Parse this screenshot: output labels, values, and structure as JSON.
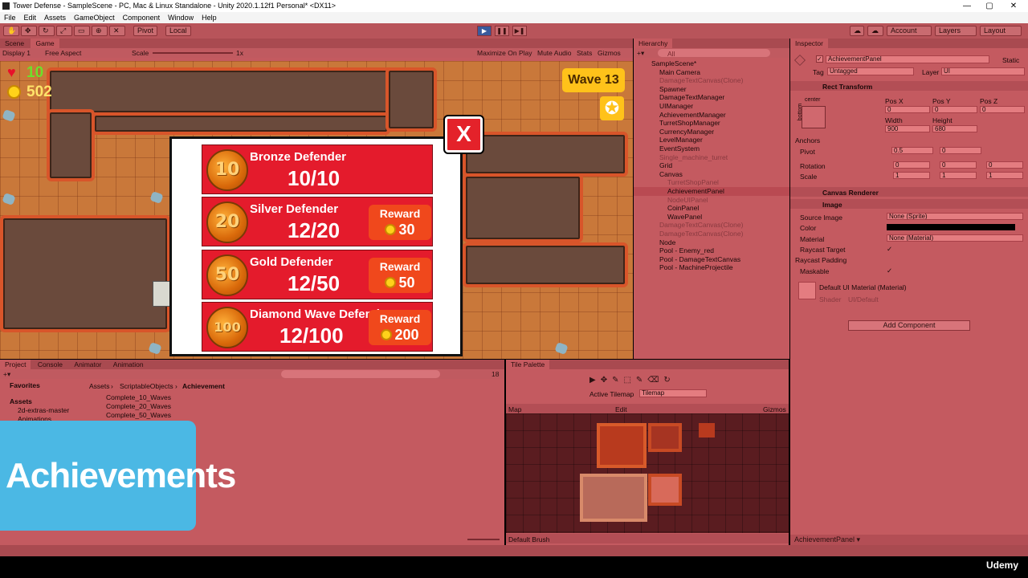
{
  "window": {
    "title": "Tower Defense - SampleScene - PC, Mac & Linux Standalone - Unity 2020.1.12f1 Personal* <DX11>",
    "min": "—",
    "max": "▢",
    "close": "✕"
  },
  "menu": [
    "File",
    "Edit",
    "Assets",
    "GameObject",
    "Component",
    "Window",
    "Help"
  ],
  "toolbar": {
    "pivot": "Pivot",
    "local": "Local",
    "account": "Account",
    "layers": "Layers",
    "layout": "Layout"
  },
  "scene_tabs": {
    "scene": "Scene",
    "game": "Game"
  },
  "game_bar": {
    "display": "Display 1",
    "aspect": "Free Aspect",
    "scale_label": "Scale",
    "scale_value": "1x",
    "maximize": "Maximize On Play",
    "mute": "Mute Audio",
    "stats": "Stats",
    "gizmos": "Gizmos"
  },
  "hud": {
    "lives": "10",
    "coins": "502",
    "wave": "Wave 13"
  },
  "achievements": [
    {
      "medal": "10",
      "title": "Bronze Defender",
      "progress": "10/10",
      "reward_label": "",
      "reward": ""
    },
    {
      "medal": "20",
      "title": "Silver Defender",
      "progress": "12/20",
      "reward_label": "Reward",
      "reward": "30"
    },
    {
      "medal": "50",
      "title": "Gold Defender",
      "progress": "12/50",
      "reward_label": "Reward",
      "reward": "50"
    },
    {
      "medal": "100",
      "title": "Diamond Wave Defender",
      "progress": "12/100",
      "reward_label": "Reward",
      "reward": "200"
    }
  ],
  "close_label": "X",
  "hierarchy": {
    "tab": "Hierarchy",
    "search": "All",
    "items": [
      {
        "label": "SampleScene*",
        "indent": 0,
        "dim": false,
        "sel": false
      },
      {
        "label": "Main Camera",
        "indent": 1,
        "dim": false,
        "sel": false
      },
      {
        "label": "DamageTextCanvas(Clone)",
        "indent": 1,
        "dim": true,
        "sel": false
      },
      {
        "label": "Spawner",
        "indent": 1,
        "dim": false,
        "sel": false
      },
      {
        "label": "DamageTextManager",
        "indent": 1,
        "dim": false,
        "sel": false
      },
      {
        "label": "UIManager",
        "indent": 1,
        "dim": false,
        "sel": false
      },
      {
        "label": "AchievementManager",
        "indent": 1,
        "dim": false,
        "sel": false
      },
      {
        "label": "TurretShopManager",
        "indent": 1,
        "dim": false,
        "sel": false
      },
      {
        "label": "CurrencyManager",
        "indent": 1,
        "dim": false,
        "sel": false
      },
      {
        "label": "LevelManager",
        "indent": 1,
        "dim": false,
        "sel": false
      },
      {
        "label": "EventSystem",
        "indent": 1,
        "dim": false,
        "sel": false
      },
      {
        "label": "Single_machine_turret",
        "indent": 1,
        "dim": true,
        "sel": false
      },
      {
        "label": "Grid",
        "indent": 1,
        "dim": false,
        "sel": false
      },
      {
        "label": "Canvas",
        "indent": 1,
        "dim": false,
        "sel": false
      },
      {
        "label": "TurretShopPanel",
        "indent": 2,
        "dim": true,
        "sel": false
      },
      {
        "label": "AchievementPanel",
        "indent": 2,
        "dim": false,
        "sel": true
      },
      {
        "label": "NodeUIPanel",
        "indent": 2,
        "dim": true,
        "sel": false
      },
      {
        "label": "CoinPanel",
        "indent": 2,
        "dim": false,
        "sel": false
      },
      {
        "label": "WavePanel",
        "indent": 2,
        "dim": false,
        "sel": false
      },
      {
        "label": "DamageTextCanvas(Clone)",
        "indent": 1,
        "dim": true,
        "sel": false
      },
      {
        "label": "DamageTextCanvas(Clone)",
        "indent": 1,
        "dim": true,
        "sel": false
      },
      {
        "label": "Node",
        "indent": 1,
        "dim": false,
        "sel": false
      },
      {
        "label": "Pool - Enemy_red",
        "indent": 1,
        "dim": false,
        "sel": false
      },
      {
        "label": "Pool - DamageTextCanvas",
        "indent": 1,
        "dim": false,
        "sel": false
      },
      {
        "label": "Pool - MachineProjectile",
        "indent": 1,
        "dim": false,
        "sel": false
      }
    ]
  },
  "inspector": {
    "tab": "Inspector",
    "name": "AchievementPanel",
    "static": "Static",
    "tag_label": "Tag",
    "tag": "Untagged",
    "layer_label": "Layer",
    "layer": "UI",
    "rect_transform": "Rect Transform",
    "anchor_h": "center",
    "anchor_v": "bottom",
    "posx_l": "Pos X",
    "posy_l": "Pos Y",
    "posz_l": "Pos Z",
    "posx": "0",
    "posy": "0",
    "posz": "0",
    "width_l": "Width",
    "height_l": "Height",
    "width": "900",
    "height": "680",
    "anchors": "Anchors",
    "pivot": "Pivot",
    "pivot_x": "0.5",
    "pivot_y": "0",
    "rotation": "Rotation",
    "rot_x": "0",
    "rot_y": "0",
    "rot_z": "0",
    "scale": "Scale",
    "scale_x": "1",
    "scale_y": "1",
    "scale_z": "1",
    "canvas_renderer": "Canvas Renderer",
    "image": "Image",
    "source_image_l": "Source Image",
    "source_image": "None (Sprite)",
    "color_l": "Color",
    "material_l": "Material",
    "material": "None (Material)",
    "raycast_target": "Raycast Target",
    "raycast_padding": "Raycast Padding",
    "maskable": "Maskable",
    "default_mat": "Default UI Material (Material)",
    "shader_l": "Shader",
    "shader": "UI/Default",
    "add_component": "Add Component",
    "footer": "AchievementPanel ▾"
  },
  "project": {
    "tabs": [
      "Project",
      "Console",
      "Animator",
      "Animation"
    ],
    "count": "18",
    "favorites": "Favorites",
    "assets": "Assets",
    "tree": [
      "2d-extras-master",
      "Animations"
    ],
    "breadcrumb": [
      "Assets",
      "ScriptableObjects",
      "Achievement"
    ],
    "files": [
      "Complete_10_Waves",
      "Complete_20_Waves",
      "Complete_50_Waves"
    ]
  },
  "tile_palette": {
    "tab": "Tile Palette",
    "active_label": "Active Tilemap",
    "active": "Tilemap",
    "palette": "Map",
    "edit": "Edit",
    "gizmos": "Gizmos",
    "brush": "Default Brush"
  },
  "banner": "Achievements",
  "watermark": "Udemy"
}
